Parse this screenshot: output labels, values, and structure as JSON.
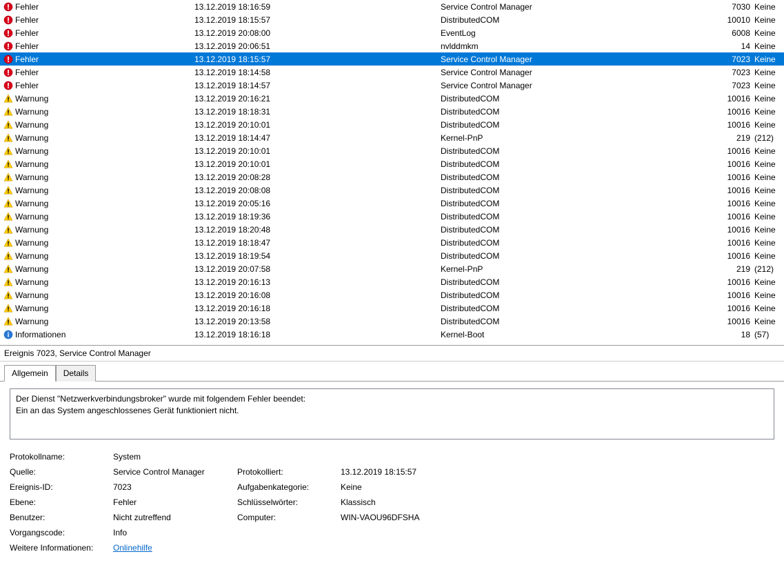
{
  "events": [
    {
      "icon": "error",
      "level": "Fehler",
      "date": "13.12.2019 18:16:59",
      "source": "Service Control Manager",
      "id": "7030",
      "task": "Keine"
    },
    {
      "icon": "error",
      "level": "Fehler",
      "date": "13.12.2019 18:15:57",
      "source": "DistributedCOM",
      "id": "10010",
      "task": "Keine"
    },
    {
      "icon": "error",
      "level": "Fehler",
      "date": "13.12.2019 20:08:00",
      "source": "EventLog",
      "id": "6008",
      "task": "Keine"
    },
    {
      "icon": "error",
      "level": "Fehler",
      "date": "13.12.2019 20:06:51",
      "source": "nvlddmkm",
      "id": "14",
      "task": "Keine"
    },
    {
      "icon": "error",
      "level": "Fehler",
      "date": "13.12.2019 18:15:57",
      "source": "Service Control Manager",
      "id": "7023",
      "task": "Keine",
      "selected": true
    },
    {
      "icon": "error",
      "level": "Fehler",
      "date": "13.12.2019 18:14:58",
      "source": "Service Control Manager",
      "id": "7023",
      "task": "Keine"
    },
    {
      "icon": "error",
      "level": "Fehler",
      "date": "13.12.2019 18:14:57",
      "source": "Service Control Manager",
      "id": "7023",
      "task": "Keine"
    },
    {
      "icon": "warning",
      "level": "Warnung",
      "date": "13.12.2019 20:16:21",
      "source": "DistributedCOM",
      "id": "10016",
      "task": "Keine"
    },
    {
      "icon": "warning",
      "level": "Warnung",
      "date": "13.12.2019 18:18:31",
      "source": "DistributedCOM",
      "id": "10016",
      "task": "Keine"
    },
    {
      "icon": "warning",
      "level": "Warnung",
      "date": "13.12.2019 20:10:01",
      "source": "DistributedCOM",
      "id": "10016",
      "task": "Keine"
    },
    {
      "icon": "warning",
      "level": "Warnung",
      "date": "13.12.2019 18:14:47",
      "source": "Kernel-PnP",
      "id": "219",
      "task": "(212)"
    },
    {
      "icon": "warning",
      "level": "Warnung",
      "date": "13.12.2019 20:10:01",
      "source": "DistributedCOM",
      "id": "10016",
      "task": "Keine"
    },
    {
      "icon": "warning",
      "level": "Warnung",
      "date": "13.12.2019 20:10:01",
      "source": "DistributedCOM",
      "id": "10016",
      "task": "Keine"
    },
    {
      "icon": "warning",
      "level": "Warnung",
      "date": "13.12.2019 20:08:28",
      "source": "DistributedCOM",
      "id": "10016",
      "task": "Keine"
    },
    {
      "icon": "warning",
      "level": "Warnung",
      "date": "13.12.2019 20:08:08",
      "source": "DistributedCOM",
      "id": "10016",
      "task": "Keine"
    },
    {
      "icon": "warning",
      "level": "Warnung",
      "date": "13.12.2019 20:05:16",
      "source": "DistributedCOM",
      "id": "10016",
      "task": "Keine"
    },
    {
      "icon": "warning",
      "level": "Warnung",
      "date": "13.12.2019 18:19:36",
      "source": "DistributedCOM",
      "id": "10016",
      "task": "Keine"
    },
    {
      "icon": "warning",
      "level": "Warnung",
      "date": "13.12.2019 18:20:48",
      "source": "DistributedCOM",
      "id": "10016",
      "task": "Keine"
    },
    {
      "icon": "warning",
      "level": "Warnung",
      "date": "13.12.2019 18:18:47",
      "source": "DistributedCOM",
      "id": "10016",
      "task": "Keine"
    },
    {
      "icon": "warning",
      "level": "Warnung",
      "date": "13.12.2019 18:19:54",
      "source": "DistributedCOM",
      "id": "10016",
      "task": "Keine"
    },
    {
      "icon": "warning",
      "level": "Warnung",
      "date": "13.12.2019 20:07:58",
      "source": "Kernel-PnP",
      "id": "219",
      "task": "(212)"
    },
    {
      "icon": "warning",
      "level": "Warnung",
      "date": "13.12.2019 20:16:13",
      "source": "DistributedCOM",
      "id": "10016",
      "task": "Keine"
    },
    {
      "icon": "warning",
      "level": "Warnung",
      "date": "13.12.2019 20:16:08",
      "source": "DistributedCOM",
      "id": "10016",
      "task": "Keine"
    },
    {
      "icon": "warning",
      "level": "Warnung",
      "date": "13.12.2019 20:16:18",
      "source": "DistributedCOM",
      "id": "10016",
      "task": "Keine"
    },
    {
      "icon": "warning",
      "level": "Warnung",
      "date": "13.12.2019 20:13:58",
      "source": "DistributedCOM",
      "id": "10016",
      "task": "Keine"
    },
    {
      "icon": "info",
      "level": "Informationen",
      "date": "13.12.2019 18:16:18",
      "source": "Kernel-Boot",
      "id": "18",
      "task": "(57)"
    }
  ],
  "detail": {
    "header": "Ereignis 7023, Service Control Manager",
    "tabs": {
      "general": "Allgemein",
      "details": "Details"
    },
    "desc_line1": "Der Dienst \"Netzwerkverbindungsbroker\" wurde mit folgendem Fehler beendet:",
    "desc_line2": "Ein an das System angeschlossenes Gerät funktioniert nicht.",
    "labels": {
      "logname": "Protokollname:",
      "source": "Quelle:",
      "logged": "Protokolliert:",
      "eventid": "Ereignis-ID:",
      "taskcat": "Aufgabenkategorie:",
      "level": "Ebene:",
      "keywords": "Schlüsselwörter:",
      "user": "Benutzer:",
      "computer": "Computer:",
      "opcode": "Vorgangscode:",
      "moreinfo": "Weitere Informationen:"
    },
    "values": {
      "logname": "System",
      "source": "Service Control Manager",
      "logged": "13.12.2019 18:15:57",
      "eventid": "7023",
      "taskcat": "Keine",
      "level": "Fehler",
      "keywords": "Klassisch",
      "user": "Nicht zutreffend",
      "computer": "WIN-VAOU96DFSHA",
      "opcode": "Info",
      "helplink": "Onlinehilfe"
    }
  }
}
